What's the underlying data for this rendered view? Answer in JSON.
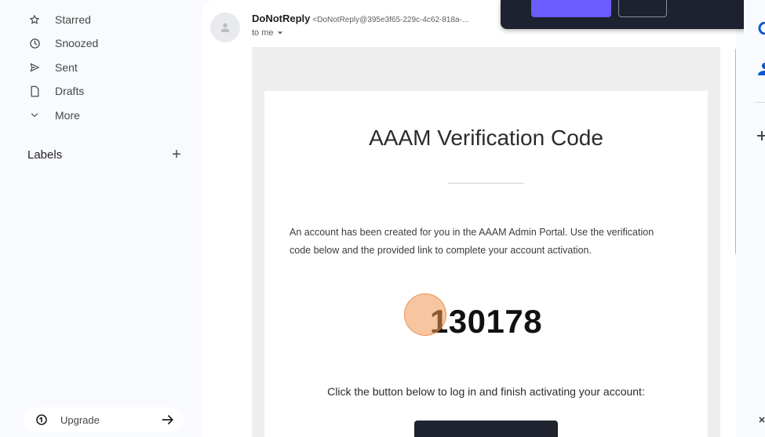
{
  "sidebar": {
    "items": [
      {
        "label": "Starred",
        "icon": "star-icon"
      },
      {
        "label": "Snoozed",
        "icon": "clock-icon"
      },
      {
        "label": "Sent",
        "icon": "send-icon"
      },
      {
        "label": "Drafts",
        "icon": "draft-icon"
      },
      {
        "label": "More",
        "icon": "chevron-down-icon"
      }
    ],
    "labels_title": "Labels",
    "labels_add": "+",
    "upgrade_label": "Upgrade"
  },
  "message": {
    "sender_name": "DoNotReply",
    "sender_email": "<DoNotReply@395e3f65-229c-4c62-818a-...",
    "to_label": "to me"
  },
  "email_body": {
    "title": "AAAM Verification Code",
    "paragraph": "An account has been created for you in the AAAM Admin Portal. Use the verification code below and the provided link to complete your account activation.",
    "code": "130178",
    "instruction": "Click the button below to log in and finish activating your account:"
  },
  "colors": {
    "sidebar_bg": "#f8fafd",
    "email_bg": "#eeeeee",
    "popup_bg": "#1e2230",
    "popup_accent": "#6a5cff",
    "cursor_highlight": "#f0964f",
    "rail_accent": "#0b57d0"
  }
}
